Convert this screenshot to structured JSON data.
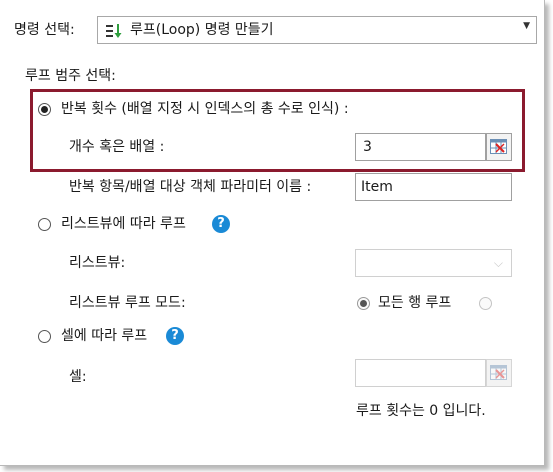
{
  "command_select": {
    "label": "명령 선택:",
    "value": "루프(Loop) 명령 만들기",
    "icon": "loop-list-icon",
    "arrow": "▼"
  },
  "loop_category": {
    "label": "루프 범주 선택:"
  },
  "option_repeat": {
    "label": "반복 횟수 (배열 지정 시 인덱스의 총 수로 인식) :",
    "selected": true,
    "count_label": "개수 혹은 배열 :",
    "count_value": "3",
    "item_param_label": "반복 항목/배열 대상 객체 파라미터 이름 :",
    "item_param_value": "Item"
  },
  "option_listview": {
    "label": "리스트뷰에 따라 루프",
    "selected": false,
    "help": "?",
    "listview_label": "리스트뷰:",
    "listview_value": "",
    "dropdown_arrow": "⌵",
    "mode_label": "리스트뷰 루프 모드:",
    "mode_all_rows": "모든 행 루프",
    "mode_all_rows_selected": true
  },
  "option_cell": {
    "label": "셀에 따라 루프",
    "selected": false,
    "help": "?",
    "cell_label": "셀:",
    "cell_value": ""
  },
  "loop_count_status": "루프 횟수는 0 입니다.",
  "colors": {
    "highlight_border": "#8b1a2e",
    "help_icon": "#1a8ad6",
    "loop_icon_green": "#2e9e3e"
  }
}
